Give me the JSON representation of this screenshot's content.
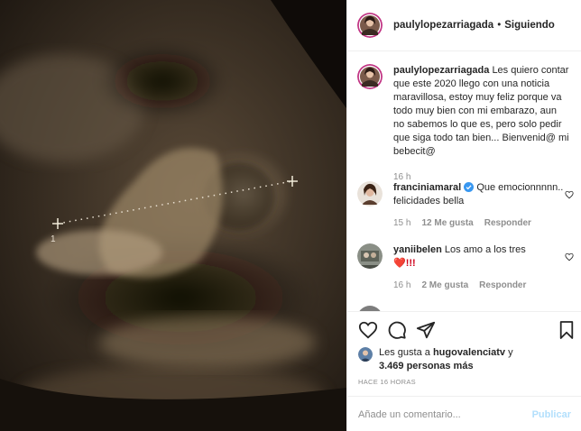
{
  "post": {
    "image_alt_icon": "ultrasound-image",
    "username": "paulylopezarriagada",
    "separator": "•",
    "follow_status": "Siguiendo"
  },
  "caption": {
    "username": "paulylopezarriagada",
    "text": "Les quiero contar que este 2020 llego con una noticia maravillosa, estoy muy feliz porque va todo muy bien con mi embarazo, aun no sabemos lo que es, pero solo pedir que siga todo tan bien... Bienvenid@ mi bebecit@",
    "time": "16 h"
  },
  "comments": [
    {
      "username": "franciniamaral",
      "verified": true,
      "text": "Que emocionnnnn.. felicidades bella",
      "time": "15 h",
      "likes": "12 Me gusta",
      "reply": "Responder"
    },
    {
      "username": "yaniibelen",
      "verified": false,
      "text": "Los amo a los tres",
      "emoji": "❤️!!!",
      "time": "16 h",
      "likes": "2 Me gusta",
      "reply": "Responder"
    }
  ],
  "likes_summary": {
    "prefix": "Les gusta a",
    "user": "hugovalenciatv",
    "connector": "y",
    "others": "3.469 personas más"
  },
  "timestamp": "HACE 16 HORAS",
  "comment_box": {
    "placeholder": "Añade un comentario...",
    "post_label": "Publicar"
  },
  "colors": {
    "verified_blue": "#3897f0",
    "post_disabled": "#b2dffc",
    "meta_gray": "#8e8e8e"
  }
}
